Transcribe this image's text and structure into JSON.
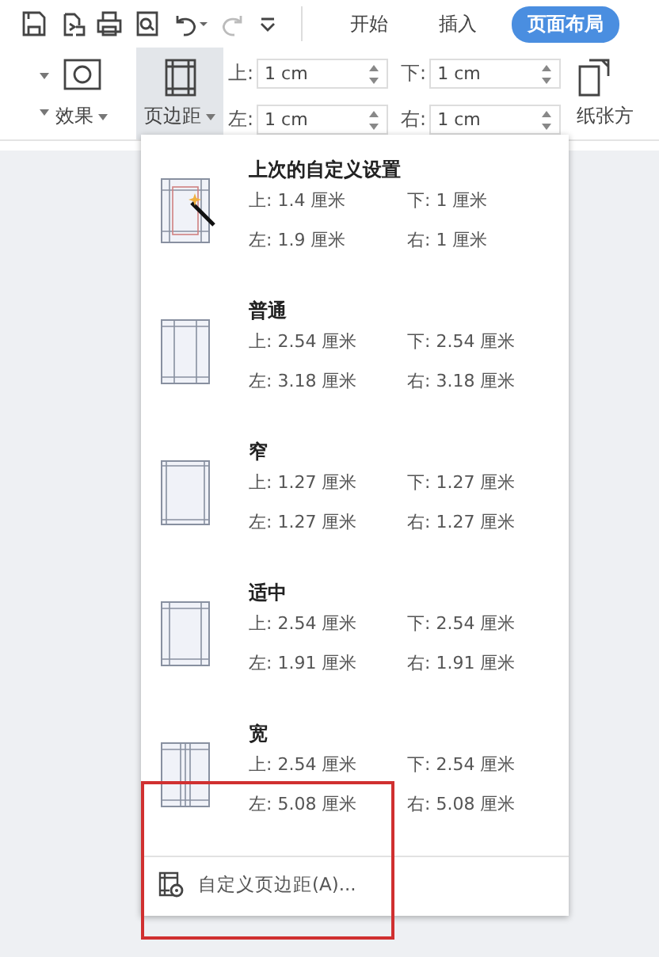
{
  "tabs": [
    {
      "label": "开始",
      "selected": false
    },
    {
      "label": "插入",
      "selected": false
    },
    {
      "label": "页面布局",
      "selected": true
    }
  ],
  "ribbon": {
    "effects_button": "效果",
    "margins_button": {
      "label": "页边距",
      "expanded": true
    },
    "margin_fields": [
      {
        "label": "上:",
        "value": "1 cm"
      },
      {
        "label": "下:",
        "value": "1 cm"
      },
      {
        "label": "左:",
        "value": "1 cm"
      },
      {
        "label": "右:",
        "value": "1 cm"
      }
    ],
    "orientation_button": "纸张方"
  },
  "menu": {
    "presets": [
      {
        "kind": "custom",
        "name": "上次的自定义设置",
        "values": [
          "上: 1.4 厘米",
          "下: 1 厘米",
          "左: 1.9 厘米",
          "右: 1 厘米"
        ]
      },
      {
        "kind": "normal",
        "name": "普通",
        "values": [
          "上: 2.54 厘米",
          "下: 2.54 厘米",
          "左: 3.18 厘米",
          "右: 3.18 厘米"
        ]
      },
      {
        "kind": "narrow",
        "name": "窄",
        "values": [
          "上: 1.27 厘米",
          "下: 1.27 厘米",
          "左: 1.27 厘米",
          "右: 1.27 厘米"
        ]
      },
      {
        "kind": "moderate",
        "name": "适中",
        "values": [
          "上: 2.54 厘米",
          "下: 2.54 厘米",
          "左: 1.91 厘米",
          "右: 1.91 厘米"
        ]
      },
      {
        "kind": "wide",
        "name": "宽",
        "values": [
          "上: 2.54 厘米",
          "下: 2.54 厘米",
          "左: 5.08 厘米",
          "右: 5.08 厘米"
        ]
      }
    ],
    "custom_item": "自定义页边距(A)..."
  }
}
